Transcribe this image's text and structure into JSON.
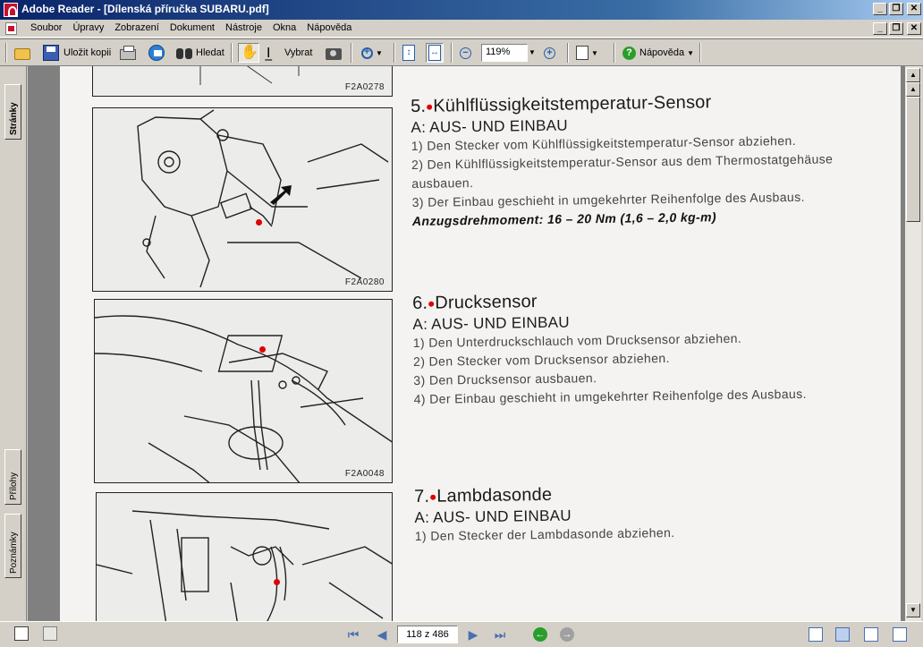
{
  "window": {
    "title": "Adobe Reader - [Dílenská příručka SUBARU.pdf]",
    "controls": [
      "_",
      "❐",
      "✕"
    ]
  },
  "menubar": {
    "items": [
      "Soubor",
      "Úpravy",
      "Zobrazení",
      "Dokument",
      "Nástroje",
      "Okna",
      "Nápověda"
    ]
  },
  "toolbar": {
    "save_copy_label": "Uložit kopii",
    "search_label": "Hledat",
    "select_label": "Vybrat",
    "zoom_value": "119%",
    "help_label": "Nápověda",
    "icons": [
      "open-folder-icon",
      "save-disk-icon",
      "print-icon",
      "email-icon",
      "binoculars-icon",
      "hand-tool-icon",
      "select-text-icon",
      "snapshot-camera-icon",
      "zoom-in-icon",
      "fit-page-icon",
      "fit-width-icon",
      "zoom-out-icon",
      "zoom-plus-icon",
      "pages-icon",
      "help-icon"
    ]
  },
  "nav_panel": {
    "tabs": [
      "Stránky",
      "Přílohy",
      "Poznámky"
    ]
  },
  "document": {
    "figures": [
      {
        "code": "F2A0278"
      },
      {
        "code": "F2A0280"
      },
      {
        "code": "F2A0048"
      },
      {
        "code": ""
      }
    ],
    "sections": [
      {
        "number": "5.",
        "title": "Kühlflüssigkeitstemperatur-Sensor",
        "subtitle": "A: AUS- UND EINBAU",
        "steps": [
          "1) Den Stecker vom Kühlflüssigkeitstemperatur-Sensor abziehen.",
          "2) Den Kühlflüssigkeitstemperatur-Sensor aus dem Thermostatgehäuse ausbauen.",
          "3) Der Einbau geschieht in umgekehrter Reihenfolge des Ausbaus."
        ],
        "torque": "Anzugsdrehmoment: 16 – 20 Nm (1,6 – 2,0 kg-m)"
      },
      {
        "number": "6.",
        "title": "Drucksensor",
        "subtitle": "A: AUS- UND EINBAU",
        "steps": [
          "1) Den Unterdruckschlauch vom Drucksensor abziehen.",
          "2) Den Stecker vom Drucksensor abziehen.",
          "3) Den Drucksensor ausbauen.",
          "4) Der Einbau geschieht in umgekehrter Reihenfolge des Ausbaus."
        ]
      },
      {
        "number": "7.",
        "title": "Lambdasonde",
        "subtitle": "A: AUS- UND EINBAU",
        "steps": [
          "1) Den Stecker der Lambdasonde abziehen."
        ]
      }
    ]
  },
  "statusbar": {
    "page_indicator": "118 z 486",
    "icons": [
      "first-page-icon",
      "previous-page-icon",
      "next-page-icon",
      "last-page-icon",
      "go-back-icon",
      "go-forward-icon",
      "single-page-icon",
      "continuous-icon",
      "continuous-facing-icon",
      "facing-icon"
    ]
  },
  "colors": {
    "titlebar_start": "#0a246a",
    "titlebar_end": "#a6caf0",
    "chrome": "#d4d0c8",
    "annotation_red": "#e00000"
  }
}
